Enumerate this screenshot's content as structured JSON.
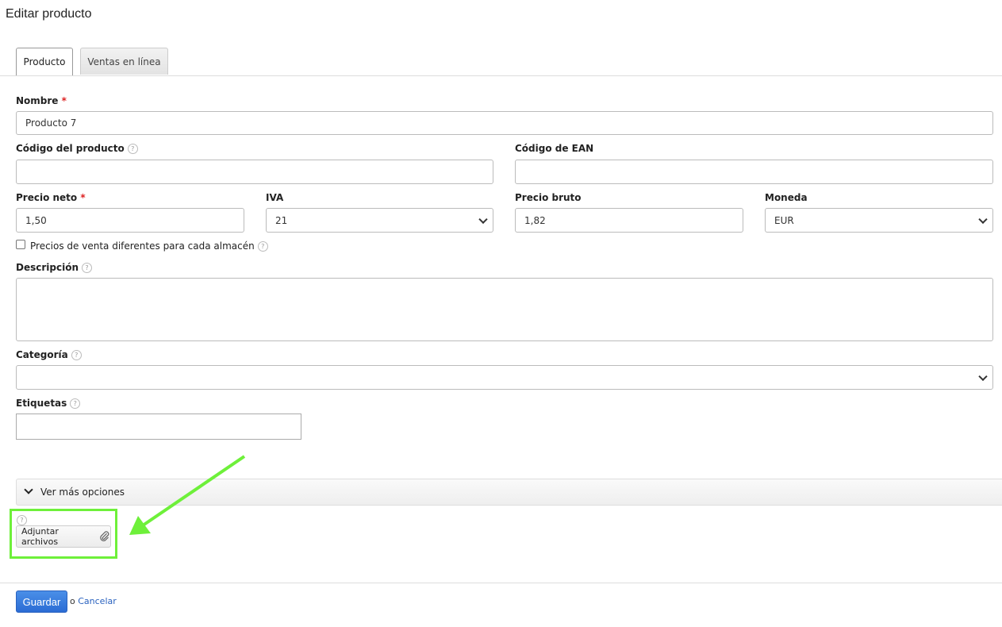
{
  "title": "Editar producto",
  "tabs": [
    {
      "label": "Producto",
      "active": true
    },
    {
      "label": "Ventas en línea",
      "active": false
    }
  ],
  "fields": {
    "nombre": {
      "label": "Nombre",
      "required": "*",
      "value": "Producto 7"
    },
    "codigo": {
      "label": "Código del producto",
      "value": ""
    },
    "ean": {
      "label": "Código de EAN",
      "value": ""
    },
    "precio_neto": {
      "label": "Precio neto",
      "required": "*",
      "value": "1,50"
    },
    "iva": {
      "label": "IVA",
      "value": "21"
    },
    "precio_bruto": {
      "label": "Precio bruto",
      "value": "1,82"
    },
    "moneda": {
      "label": "Moneda",
      "value": "EUR"
    },
    "almacen": {
      "label": "Precios de venta diferentes para cada almacén",
      "checked": false
    },
    "descripcion": {
      "label": "Descripción",
      "value": ""
    },
    "categoria": {
      "label": "Categoría",
      "value": ""
    },
    "etiquetas": {
      "label": "Etiquetas",
      "value": ""
    }
  },
  "help_glyph": "?",
  "more_options": "Ver más opciones",
  "attach_label": "Adjuntar archivos",
  "save_label": "Guardar",
  "or_text": "o",
  "cancel_label": "Cancelar",
  "colors": {
    "highlight": "#6ef03a",
    "primary": "#2b6cd4"
  }
}
